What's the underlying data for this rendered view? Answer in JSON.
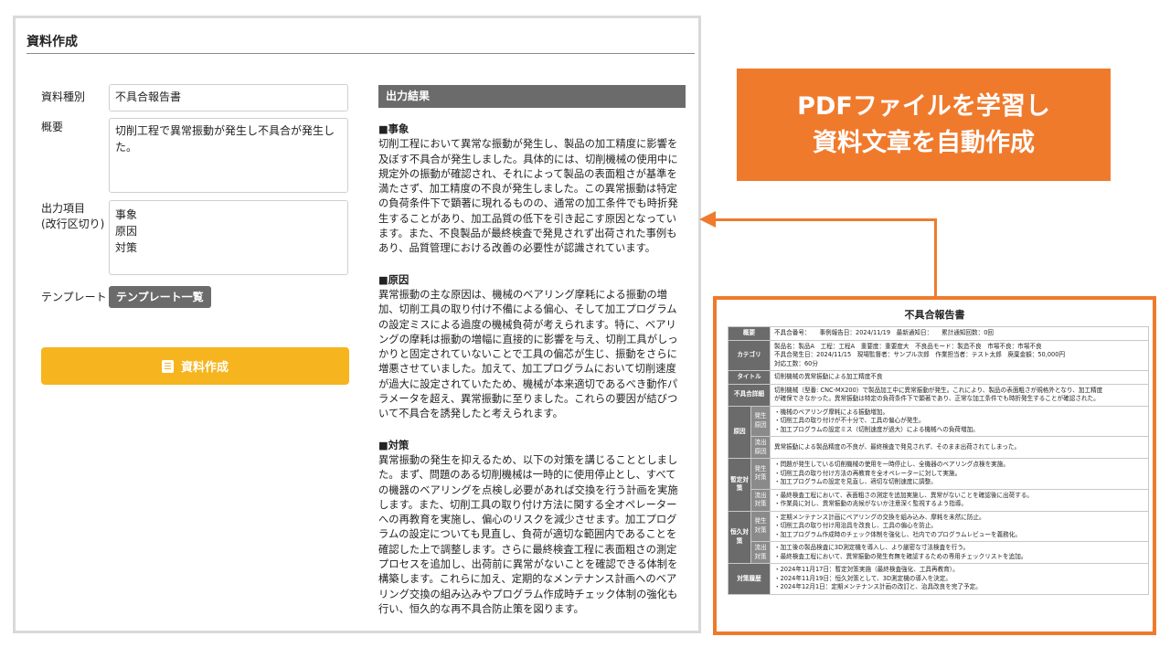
{
  "panel": {
    "title": "資料作成",
    "form": {
      "type_label": "資料種別",
      "type_value": "不具合報告書",
      "summary_label": "概要",
      "summary_lines": [
        "切削工程で異常振動が発生し不具合が発生し",
        "た。"
      ],
      "output_label_line1": "出力項目",
      "output_label_line2": "(改行区切り)",
      "output_lines": [
        "事象",
        "原因",
        "対策"
      ],
      "template_label": "テンプレート",
      "template_button": "テンプレート一覧",
      "create_button": "資料作成"
    },
    "output": {
      "header": "出力結果",
      "sections": [
        {
          "title": "■事象",
          "lines": [
            "切削工程において異常な振動が発生し、製品の加工精度に影響を",
            "及ぼす不具合が発生しました。具体的には、切削機械の使用中に",
            "規定外の振動が確認され、それによって製品の表面粗さが基準を",
            "満たさず、加工精度の不良が発生しました。この異常振動は特定",
            "の負荷条件下で顕著に現れるものの、通常の加工条件でも時折発",
            "生することがあり、加工品質の低下を引き起こす原因となってい",
            "ます。また、不良製品が最終検査で発見されず出荷された事例も",
            "あり、品質管理における改善の必要性が認識されています。"
          ]
        },
        {
          "title": "■原因",
          "lines": [
            "異常振動の主な原因は、機械のベアリング摩耗による振動の増",
            "加、切削工具の取り付け不備による偏心、そして加工プログラム",
            "の設定ミスによる過度の機械負荷が考えられます。特に、ベアリ",
            "ングの摩耗は振動の増幅に直接的に影響を与え、切削工具がしっ",
            "かりと固定されていないことで工具の偏芯が生じ、振動をさらに",
            "増悪させていました。加えて、加工プログラムにおいて切削速度",
            "が過大に設定されていたため、機械が本来適切であるべき動作パ",
            "ラメータを超え、異常振動に至りました。これらの要因が結びつ",
            "いて不具合を誘発したと考えられます。"
          ]
        },
        {
          "title": "■対策",
          "lines": [
            "異常振動の発生を抑えるため、以下の対策を講じることとしまし",
            "た。まず、問題のある切削機械は一時的に使用停止とし、すべて",
            "の機器のベアリングを点検し必要があれば交換を行う計画を実施",
            "します。また、切削工具の取り付け方法に関する全オペレーター",
            "への再教育を実施し、偏心のリスクを減少させます。加工プログ",
            "ラムの設定についても見直し、負荷が適切な範囲内であることを",
            "確認した上で調整します。さらに最終検査工程に表面粗さの測定",
            "プロセスを追加し、出荷前に異常がないことを確認できる体制を",
            "構築します。これらに加え、定期的なメンテナンス計画へのベア",
            "リング交換の組み込みやプログラム作成時チェック体制の強化も",
            "行い、恒久的な再不具合防止策を図ります。"
          ]
        }
      ]
    }
  },
  "callout": {
    "line1": "PDFファイルを学習し",
    "line2": "資料文章を自動作成"
  },
  "report": {
    "title": "不具合報告書",
    "rows": {
      "overview_h": "概要",
      "overview_lines": [
        "不具合番号：　　事例報告日：2024/11/19　最新通知日：　　累計通知回数：0回"
      ],
      "category_h": "カテゴリ",
      "category_lines": [
        "製品名：製品A　工程：工程A　重要度：重要度大　不良品モード：製造不良　市場不良：市場不良",
        "不具合発生日：2024/11/15　現場監督者：サンプル次郎　作業担当者：テスト太郎　廃棄金額：50,000円",
        "対応工数：60分"
      ],
      "title_h": "タイトル",
      "title_lines": [
        "切削機械の異常振動による加工精度不良"
      ],
      "detail_h": "不具合詳細",
      "detail_lines": [
        "切削機械（型番: CNC-MX200）で製品加工中に異常振動が発生。これにより、製品の表面粗さが規格外となり、加工精度",
        "が確保できなかった。異常振動は特定の負荷条件下で顕著であり、正常な加工条件でも時折発生することが確認された。"
      ],
      "cause_h": "原因",
      "cause_occ_h": "発生原因",
      "cause_occ_lines": [
        "・機械のベアリング摩耗による振動増加。",
        "・切削工具の取り付けが不十分で、工具の偏心が発生。",
        "・加工プログラムの設定ミス（切削速度が過大）による機械への負荷増加。"
      ],
      "cause_out_h": "流出原因",
      "cause_out_lines": [
        "異常振動による製品精度の不良が、最終検査で発見されず、そのまま出荷されてしまった。"
      ],
      "temp_h": "暫定対策",
      "temp_occ_h": "発生対策",
      "temp_occ_lines": [
        "・問題が発生している切削機械の使用を一時停止し、全機器のベアリング点検を実施。",
        "・切削工具の取り付け方法の再教育を全オペレーターに対して実施。",
        "・加工プログラムの設定を見直し、適切な切削速度に調整。"
      ],
      "temp_out_h": "流出対策",
      "temp_out_lines": [
        "・最終検査工程において、表面粗さの測定を追加実施し、異常がないことを確認後に出荷する。",
        "・作業員に対し、異常振動の兆候がないか注意深く監視するよう指導。"
      ],
      "perm_h": "恒久対策",
      "perm_occ_h": "発生対策",
      "perm_occ_lines": [
        "・定期メンテナンス計画にベアリングの交換を組み込み、摩耗を未然に防止。",
        "・切削工具の取り付け用治具を改良し、工具の偏心を防止。",
        "・加工プログラム作成時のチェック体制を強化し、社内でのプログラムレビューを義務化。"
      ],
      "perm_out_h": "流出対策",
      "perm_out_lines": [
        "・加工後の製品検査に3D測定機を導入し、より厳密な寸法検査を行う。",
        "・最終検査工程において、異常振動の発生有無を確認するための専用チェックリストを追加。"
      ],
      "history_h": "対策履歴",
      "history_lines": [
        "・2024年11月17日：暫定対策実施（最終検査強化、工具再教育）。",
        "・2024年11月19日：恒久対策として、3D測定機の導入を決定。",
        "・2024年12月1日：定期メンテナンス計画の改訂と、治具改良を完了予定。"
      ]
    }
  }
}
